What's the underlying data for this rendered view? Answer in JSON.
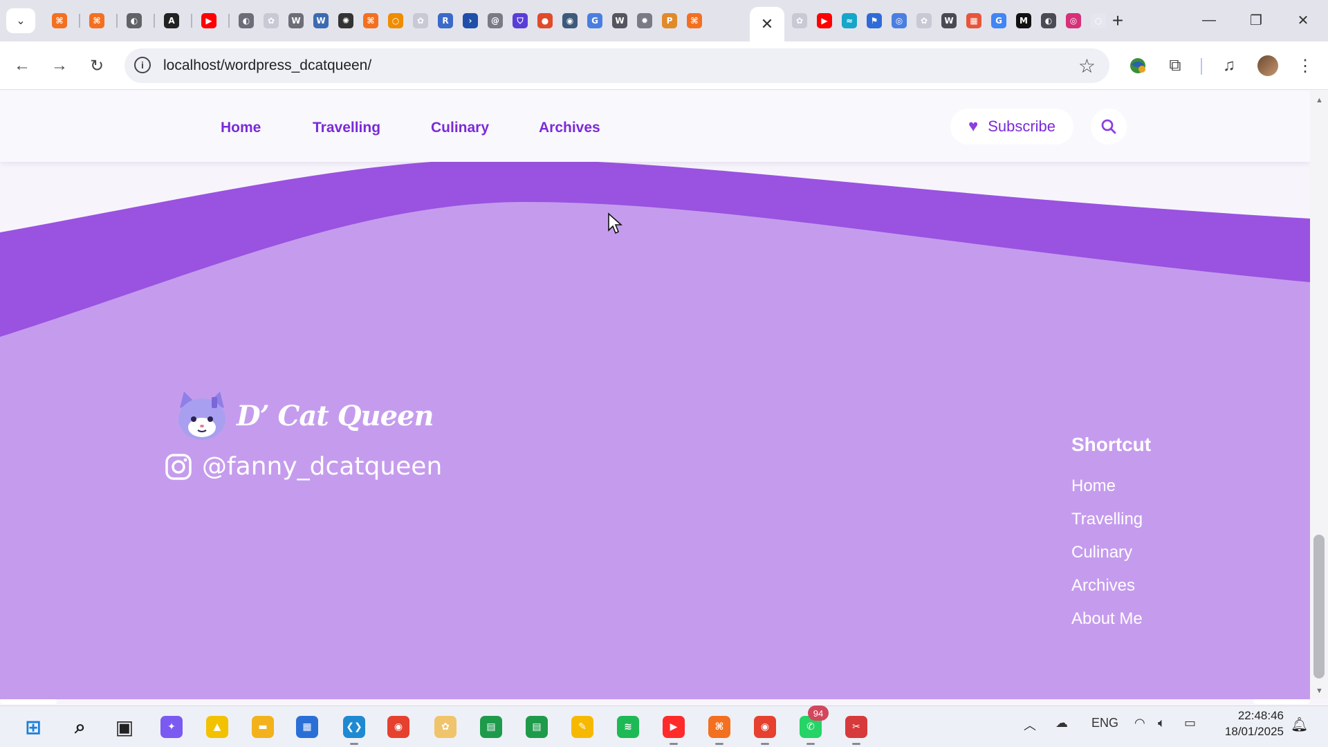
{
  "browser": {
    "url": "localhost/wordpress_dcatqueen/",
    "tabs_before": [
      {
        "icon": "xampp-icon",
        "color": "#f37021",
        "glyph": "⌘"
      },
      {
        "icon": "xampp-icon",
        "color": "#f37021",
        "glyph": "⌘"
      },
      {
        "icon": "globe-icon",
        "color": "#5f6368",
        "glyph": "◐"
      },
      {
        "icon": "font-icon",
        "color": "#222222",
        "glyph": "A"
      },
      {
        "icon": "youtube-icon",
        "color": "#ff0000",
        "glyph": "▶"
      }
    ],
    "tabs_middle": [
      {
        "icon": "globe-icon",
        "color": "#6d6d77",
        "glyph": "◐"
      },
      {
        "icon": "paw-icon",
        "color": "#c9c9d6",
        "glyph": "✿"
      },
      {
        "icon": "wordpress-icon",
        "color": "#6d6d77",
        "glyph": "W"
      },
      {
        "icon": "wordpress-icon",
        "color": "#3c6bb0",
        "glyph": "W"
      },
      {
        "icon": "openai-icon",
        "color": "#333333",
        "glyph": "✺"
      },
      {
        "icon": "xampp-icon",
        "color": "#f37021",
        "glyph": "⌘"
      },
      {
        "icon": "circle-icon",
        "color": "#f08c00",
        "glyph": "○"
      },
      {
        "icon": "paw-icon",
        "color": "#c9c9d6",
        "glyph": "✿"
      },
      {
        "icon": "repo-icon",
        "color": "#3b6ac9",
        "glyph": "R"
      },
      {
        "icon": "terminal-icon",
        "color": "#1f4fa8",
        "glyph": "›"
      },
      {
        "icon": "link-icon",
        "color": "#7a7a86",
        "glyph": "@"
      },
      {
        "icon": "shield-icon",
        "color": "#5a3fd6",
        "glyph": "⛉"
      },
      {
        "icon": "dots-icon",
        "color": "#e04b2a",
        "glyph": "●"
      },
      {
        "icon": "steam-icon",
        "color": "#3e5a7a",
        "glyph": "◉"
      },
      {
        "icon": "translate-icon",
        "color": "#4a7fe0",
        "glyph": "G"
      },
      {
        "icon": "wordpress-icon",
        "color": "#555560",
        "glyph": "W"
      },
      {
        "icon": "gear-icon",
        "color": "#7a7a86",
        "glyph": "✹"
      },
      {
        "icon": "phpmyadmin-icon",
        "color": "#e08a2a",
        "glyph": "P"
      },
      {
        "icon": "xampp-icon",
        "color": "#f37021",
        "glyph": "⌘"
      }
    ],
    "tabs_after": [
      {
        "icon": "paw-icon",
        "color": "#c9c9d6",
        "glyph": "✿"
      },
      {
        "icon": "youtube-icon",
        "color": "#ff0000",
        "glyph": "▶"
      },
      {
        "icon": "tailwind-icon",
        "color": "#16a6c9",
        "glyph": "≈"
      },
      {
        "icon": "flag-icon",
        "color": "#2f6bd8",
        "glyph": "⚑"
      },
      {
        "icon": "chrome-web-icon",
        "color": "#4a7fe0",
        "glyph": "◎"
      },
      {
        "icon": "paw-icon",
        "color": "#c9c9d6",
        "glyph": "✿"
      },
      {
        "icon": "w3c-icon",
        "color": "#4a4a55",
        "glyph": "W"
      },
      {
        "icon": "grid-icon",
        "color": "#e8553a",
        "glyph": "▦"
      },
      {
        "icon": "google-icon",
        "color": "#4285f4",
        "glyph": "G"
      },
      {
        "icon": "medium-icon",
        "color": "#111111",
        "glyph": "M"
      },
      {
        "icon": "globe-icon",
        "color": "#4a4a55",
        "glyph": "◐"
      },
      {
        "icon": "instagram-icon",
        "color": "#d6307a",
        "glyph": "◎"
      },
      {
        "icon": "blank-icon",
        "color": "#e6e6ee",
        "glyph": "○"
      }
    ],
    "active_tab_close": "✕"
  },
  "site": {
    "nav": [
      {
        "label": "Home"
      },
      {
        "label": "Travelling"
      },
      {
        "label": "Culinary"
      },
      {
        "label": "Archives"
      }
    ],
    "subscribe_label": "Subscribe"
  },
  "footer": {
    "brand": "D’ Cat Queen",
    "instagram_handle": "@fanny_dcatqueen",
    "shortcut_title": "Shortcut",
    "shortcuts": [
      "Home",
      "Travelling",
      "Culinary",
      "Archives",
      "About Me"
    ],
    "colors": {
      "wave_dark": "#9a52e0",
      "wave_light": "#c59ced"
    }
  },
  "taskbar": {
    "apps": [
      {
        "name": "windows-start-icon",
        "color": "#1a7fd8",
        "glyph": "⊞"
      },
      {
        "name": "search-icon",
        "color": "#222222",
        "glyph": "⌕"
      },
      {
        "name": "task-view-icon",
        "color": "#222222",
        "glyph": "▣"
      },
      {
        "name": "copilot-icon",
        "color": "#7a5af0",
        "glyph": "✦"
      },
      {
        "name": "app-triangle-icon",
        "color": "#f2c200",
        "glyph": "▲"
      },
      {
        "name": "file-explorer-icon",
        "color": "#f3b21b",
        "glyph": "▬"
      },
      {
        "name": "microsoft-store-icon",
        "color": "#2a6fd6",
        "glyph": "▦"
      },
      {
        "name": "vscode-icon",
        "color": "#1f8ad2",
        "glyph": "❮❯"
      },
      {
        "name": "chrome-icon",
        "color": "#e6402f",
        "glyph": "◉"
      },
      {
        "name": "paw-app-icon",
        "color": "#f0c46a",
        "glyph": "✿"
      },
      {
        "name": "classroom-icon",
        "color": "#1e9a4b",
        "glyph": "▤"
      },
      {
        "name": "classroom-icon-2",
        "color": "#1e9a4b",
        "glyph": "▤"
      },
      {
        "name": "keep-icon",
        "color": "#f7b900",
        "glyph": "✎"
      },
      {
        "name": "spotify-icon",
        "color": "#1db954",
        "glyph": "≋"
      },
      {
        "name": "youtube-music-icon",
        "color": "#ff2b2b",
        "glyph": "▶"
      },
      {
        "name": "xampp-icon",
        "color": "#f37021",
        "glyph": "⌘"
      },
      {
        "name": "chrome-profile-icon",
        "color": "#e6402f",
        "glyph": "◉"
      },
      {
        "name": "whatsapp-icon",
        "color": "#25d366",
        "glyph": "✆"
      },
      {
        "name": "snipping-tool-icon",
        "color": "#d63a3a",
        "glyph": "✂"
      }
    ],
    "whatsapp_badge": "94",
    "language": "ENG",
    "time": "22:48:46",
    "date": "18/01/2025"
  }
}
